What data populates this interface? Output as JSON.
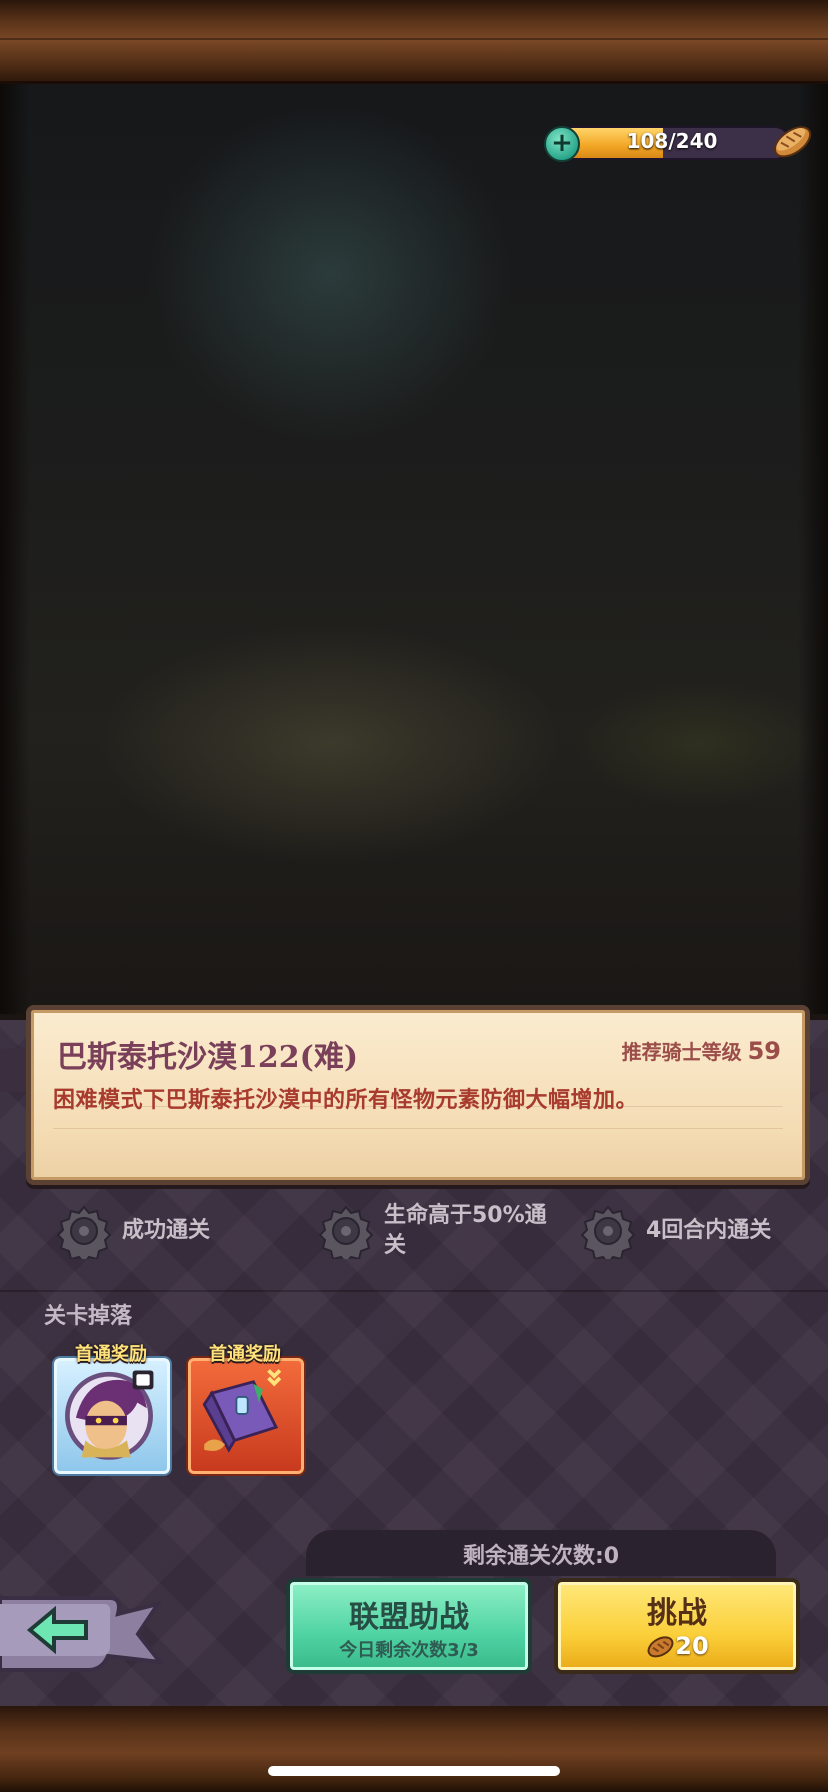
{
  "stamina": {
    "text": "108/240",
    "current": 108,
    "max": 240
  },
  "stage": {
    "title": "巴斯泰托沙漠122(难)",
    "recommend_label": "推荐骑士等级",
    "recommend_level": "59",
    "description": "困难模式下巴斯泰托沙漠中的所有怪物元素防御大幅增加。"
  },
  "goals": [
    {
      "text": "成功通关",
      "icon": "gear-icon"
    },
    {
      "text": "生命高于50%通\n关",
      "icon": "gear-icon"
    },
    {
      "text": "4回合内通关",
      "icon": "gear-icon"
    }
  ],
  "drops": {
    "title": "关卡掉落",
    "rewards": [
      {
        "label": "首通奖励",
        "icon": "masked-hero-portrait-icon"
      },
      {
        "label": "首通奖励",
        "icon": "spell-book-icon"
      }
    ]
  },
  "remaining_clears": "剩余通关次数:0",
  "buttons": {
    "ally_label": "联盟助战",
    "ally_sub": "今日剩余次数3/3",
    "challenge_label": "挑战",
    "challenge_cost": "20"
  },
  "icons": {
    "back": "back-arrow-icon",
    "plus": "plus-icon",
    "stamina": "bread-icon"
  },
  "colors": {
    "accent_green": "#4fd3a3",
    "accent_yellow": "#fbcf3a",
    "title_purple": "#7a3f59",
    "desc_red": "#a83a2e"
  }
}
